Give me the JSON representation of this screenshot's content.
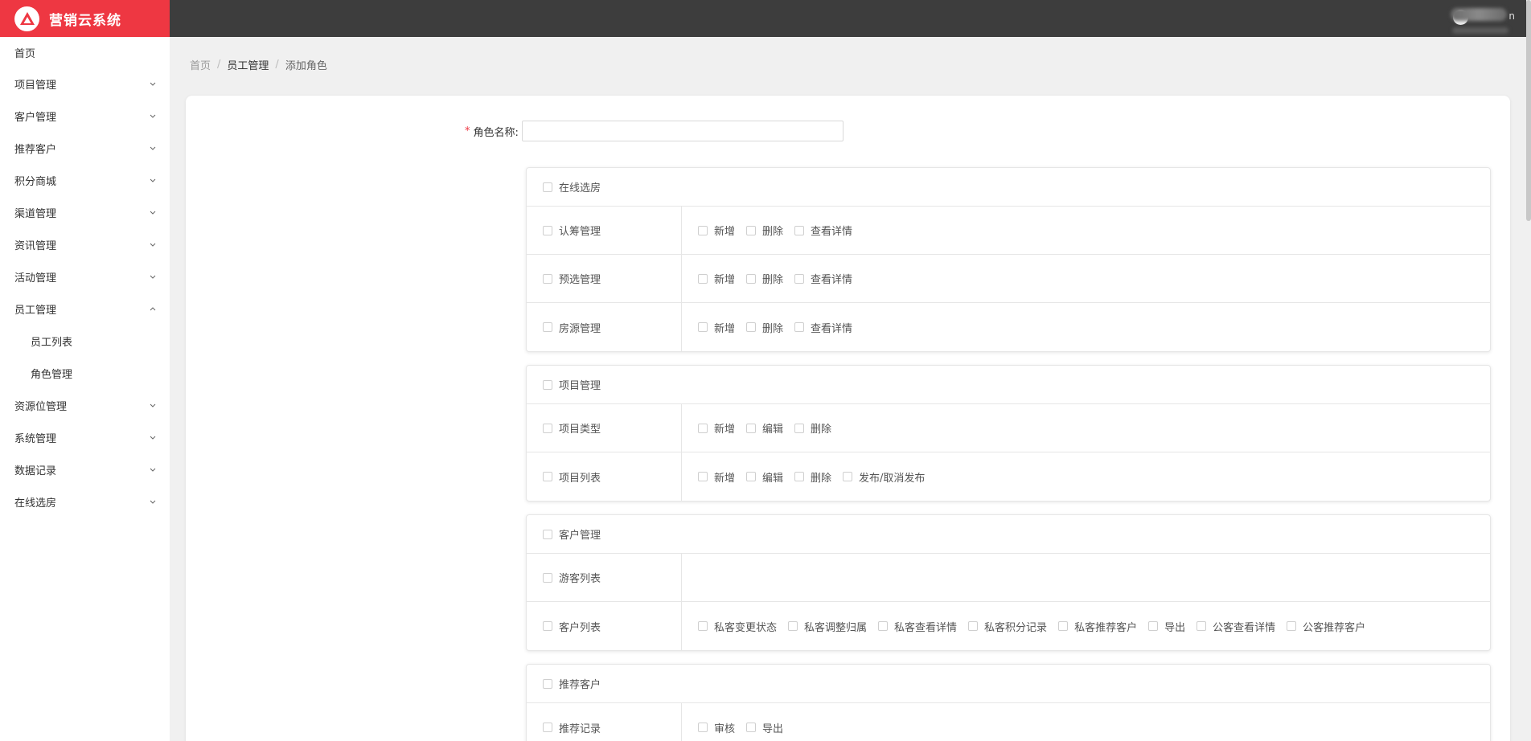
{
  "app": {
    "title": "营销云系统"
  },
  "sidebar": {
    "items": [
      {
        "label": "首页"
      },
      {
        "label": "项目管理"
      },
      {
        "label": "客户管理"
      },
      {
        "label": "推荐客户"
      },
      {
        "label": "积分商城"
      },
      {
        "label": "渠道管理"
      },
      {
        "label": "资讯管理"
      },
      {
        "label": "活动管理"
      },
      {
        "label": "员工管理"
      },
      {
        "label": "员工列表"
      },
      {
        "label": "角色管理"
      },
      {
        "label": "资源位管理"
      },
      {
        "label": "系统管理"
      },
      {
        "label": "数据记录"
      },
      {
        "label": "在线选房"
      }
    ]
  },
  "header": {
    "user_suffix": "n"
  },
  "breadcrumb": {
    "home": "首页",
    "sep": "/",
    "parent": "员工管理",
    "current": "添加角色"
  },
  "form": {
    "required_mark": "*",
    "role_name_label": "角色名称:",
    "role_name_value": ""
  },
  "groups": [
    {
      "title": "在线选房",
      "rows": [
        {
          "name": "认筹管理",
          "perms": [
            "新增",
            "删除",
            "查看详情"
          ]
        },
        {
          "name": "预选管理",
          "perms": [
            "新增",
            "删除",
            "查看详情"
          ]
        },
        {
          "name": "房源管理",
          "perms": [
            "新增",
            "删除",
            "查看详情"
          ]
        }
      ]
    },
    {
      "title": "项目管理",
      "rows": [
        {
          "name": "项目类型",
          "perms": [
            "新增",
            "编辑",
            "删除"
          ]
        },
        {
          "name": "项目列表",
          "perms": [
            "新增",
            "编辑",
            "删除",
            "发布/取消发布"
          ]
        }
      ]
    },
    {
      "title": "客户管理",
      "rows": [
        {
          "name": "游客列表",
          "perms": []
        },
        {
          "name": "客户列表",
          "perms": [
            "私客变更状态",
            "私客调整归属",
            "私客查看详情",
            "私客积分记录",
            "私客推荐客户",
            "导出",
            "公客查看详情",
            "公客推荐客户"
          ]
        }
      ]
    },
    {
      "title": "推荐客户",
      "rows": [
        {
          "name": "推荐记录",
          "perms": [
            "审核",
            "导出"
          ]
        }
      ]
    }
  ]
}
